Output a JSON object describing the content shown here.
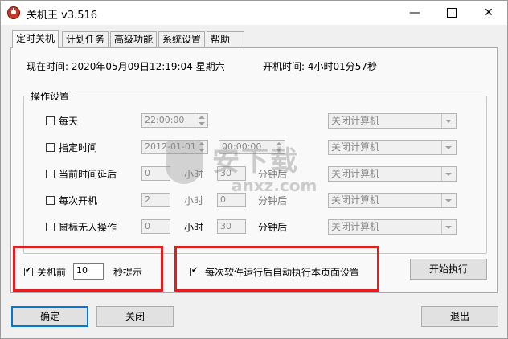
{
  "window": {
    "title": "关机王 v3.516",
    "min_glyph": "—",
    "close_glyph": "✕"
  },
  "tabs": [
    {
      "label": "定时关机",
      "active": true
    },
    {
      "label": "计划任务"
    },
    {
      "label": "高级功能"
    },
    {
      "label": "系统设置"
    },
    {
      "label": "帮助"
    }
  ],
  "info": {
    "current_time": "现在时间:  2020年05月09日12:19:04  星期六",
    "uptime": "开机时间:  4小时01分57秒"
  },
  "group": {
    "title": "操作设置"
  },
  "rows": [
    {
      "label": "每天",
      "field": "22:00:00",
      "action": "关闭计算机"
    },
    {
      "label": "指定时间",
      "date": "2012-01-01",
      "field": "00:00:00",
      "action": "关闭计算机"
    },
    {
      "label": "当前时间延后",
      "hours": "0",
      "hour_unit": "小时",
      "minutes": "30",
      "min_unit": "分钟后",
      "action": "关闭计算机"
    },
    {
      "label": "每次开机",
      "hours": "2",
      "hour_unit": "小时",
      "minutes": "0",
      "min_unit": "分钟后",
      "action": "关闭计算机"
    },
    {
      "label": "鼠标无人操作",
      "hours": "0",
      "hour_unit": "小时",
      "minutes": "30",
      "min_unit": "分钟后",
      "action": "关闭计算机"
    }
  ],
  "prompt": {
    "label_before": "关机前",
    "value": "10",
    "label_after": "秒提示",
    "checked": true
  },
  "autorun": {
    "label": "每次软件运行后自动执行本页面设置",
    "checked": true
  },
  "buttons": {
    "start": "开始执行",
    "ok": "确定",
    "close": "关闭",
    "exit": "退出"
  },
  "colors": {
    "highlight_box": "#e02020",
    "accent": "#0078d7"
  }
}
